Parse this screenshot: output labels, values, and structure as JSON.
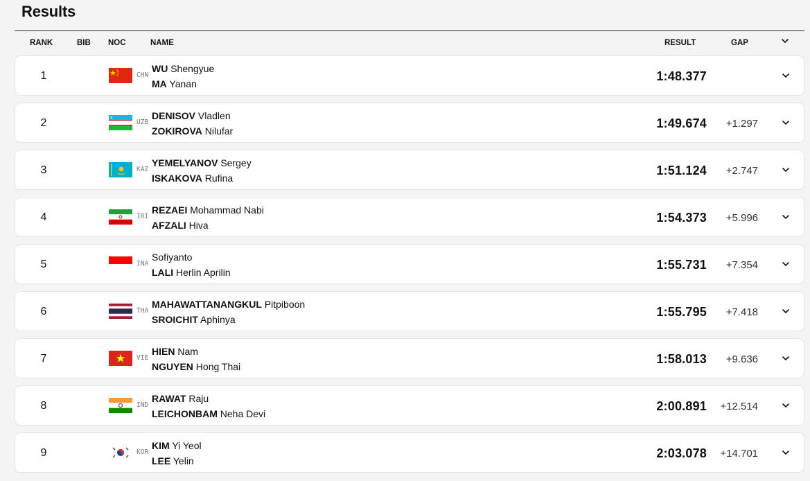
{
  "page": {
    "title": "Results"
  },
  "columns": {
    "rank": "RANK",
    "bib": "BIB",
    "noc": "NOC",
    "name": "NAME",
    "result": "RESULT",
    "gap": "GAP"
  },
  "rows": [
    {
      "rank": "1",
      "noc": "CHN",
      "flag_icon": "flag-china-icon",
      "athletes": [
        {
          "surname": "WU",
          "given": "Shengyue"
        },
        {
          "surname": "MA",
          "given": "Yanan"
        }
      ],
      "result": "1:48.377",
      "gap": ""
    },
    {
      "rank": "2",
      "noc": "UZB",
      "flag_icon": "flag-uzbekistan-icon",
      "athletes": [
        {
          "surname": "DENISOV",
          "given": "Vladlen"
        },
        {
          "surname": "ZOKIROVA",
          "given": "Nilufar"
        }
      ],
      "result": "1:49.674",
      "gap": "+1.297"
    },
    {
      "rank": "3",
      "noc": "KAZ",
      "flag_icon": "flag-kazakhstan-icon",
      "athletes": [
        {
          "surname": "YEMELYANOV",
          "given": "Sergey"
        },
        {
          "surname": "ISKAKOVA",
          "given": "Rufina"
        }
      ],
      "result": "1:51.124",
      "gap": "+2.747"
    },
    {
      "rank": "4",
      "noc": "IRI",
      "flag_icon": "flag-iran-icon",
      "athletes": [
        {
          "surname": "REZAEI",
          "given": "Mohammad Nabi"
        },
        {
          "surname": "AFZALI",
          "given": "Hiva"
        }
      ],
      "result": "1:54.373",
      "gap": "+5.996"
    },
    {
      "rank": "5",
      "noc": "INA",
      "flag_icon": "flag-indonesia-icon",
      "athletes": [
        {
          "surname": "",
          "given": "Sofiyanto"
        },
        {
          "surname": "LALI",
          "given": "Herlin Aprilin"
        }
      ],
      "result": "1:55.731",
      "gap": "+7.354"
    },
    {
      "rank": "6",
      "noc": "THA",
      "flag_icon": "flag-thailand-icon",
      "athletes": [
        {
          "surname": "MAHAWATTANANGKUL",
          "given": "Pitpiboon"
        },
        {
          "surname": "SROICHIT",
          "given": "Aphinya"
        }
      ],
      "result": "1:55.795",
      "gap": "+7.418"
    },
    {
      "rank": "7",
      "noc": "VIE",
      "flag_icon": "flag-vietnam-icon",
      "athletes": [
        {
          "surname": "HIEN",
          "given": "Nam"
        },
        {
          "surname": "NGUYEN",
          "given": "Hong Thai"
        }
      ],
      "result": "1:58.013",
      "gap": "+9.636"
    },
    {
      "rank": "8",
      "noc": "IND",
      "flag_icon": "flag-india-icon",
      "athletes": [
        {
          "surname": "RAWAT",
          "given": "Raju"
        },
        {
          "surname": "LEICHONBAM",
          "given": "Neha Devi"
        }
      ],
      "result": "2:00.891",
      "gap": "+12.514"
    },
    {
      "rank": "9",
      "noc": "KOR",
      "flag_icon": "flag-south-korea-icon",
      "athletes": [
        {
          "surname": "KIM",
          "given": "Yi Yeol"
        },
        {
          "surname": "LEE",
          "given": "Yelin"
        }
      ],
      "result": "2:03.078",
      "gap": "+14.701"
    }
  ]
}
